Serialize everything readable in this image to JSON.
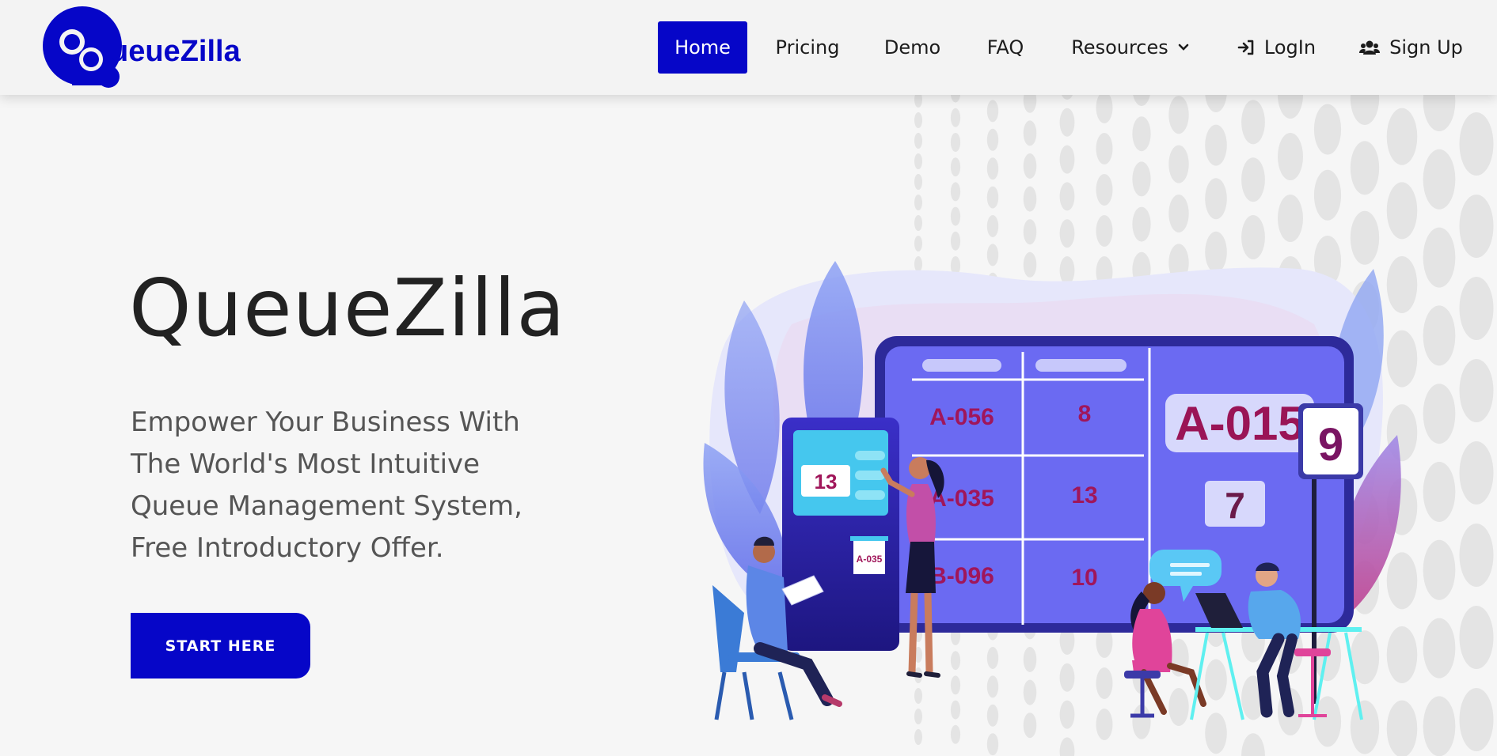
{
  "brand": {
    "logo_text": "ueueZilla",
    "logo_color": "#0606c8"
  },
  "nav": {
    "items": [
      {
        "label": "Home",
        "active": true
      },
      {
        "label": "Pricing"
      },
      {
        "label": "Demo"
      },
      {
        "label": "FAQ"
      },
      {
        "label": "Resources",
        "icon": "chevron-down-icon"
      },
      {
        "label": "LogIn",
        "icon": "sign-in-icon"
      },
      {
        "label": "Sign Up",
        "icon": "users-icon"
      }
    ]
  },
  "hero": {
    "title": "QueueZilla",
    "subtitle_lines": [
      "Empower Your Business With",
      "The World's Most Intuitive",
      "Queue Management System,",
      "Free Introductory Offer."
    ],
    "cta_label": "START HERE"
  },
  "illustration": {
    "board": {
      "rows": [
        {
          "ticket": "A-056",
          "counter": "8"
        },
        {
          "ticket": "A-035",
          "counter": "13"
        },
        {
          "ticket": "B-096",
          "counter": "10"
        }
      ],
      "current_ticket": "A-015",
      "current_counter": "7"
    },
    "kiosk_number": "13",
    "kiosk_ticket": "A-035",
    "stand_sign": "9"
  },
  "colors": {
    "accent": "#0606c8",
    "board": "#6b6af2",
    "ticket_text": "#a0165a"
  }
}
